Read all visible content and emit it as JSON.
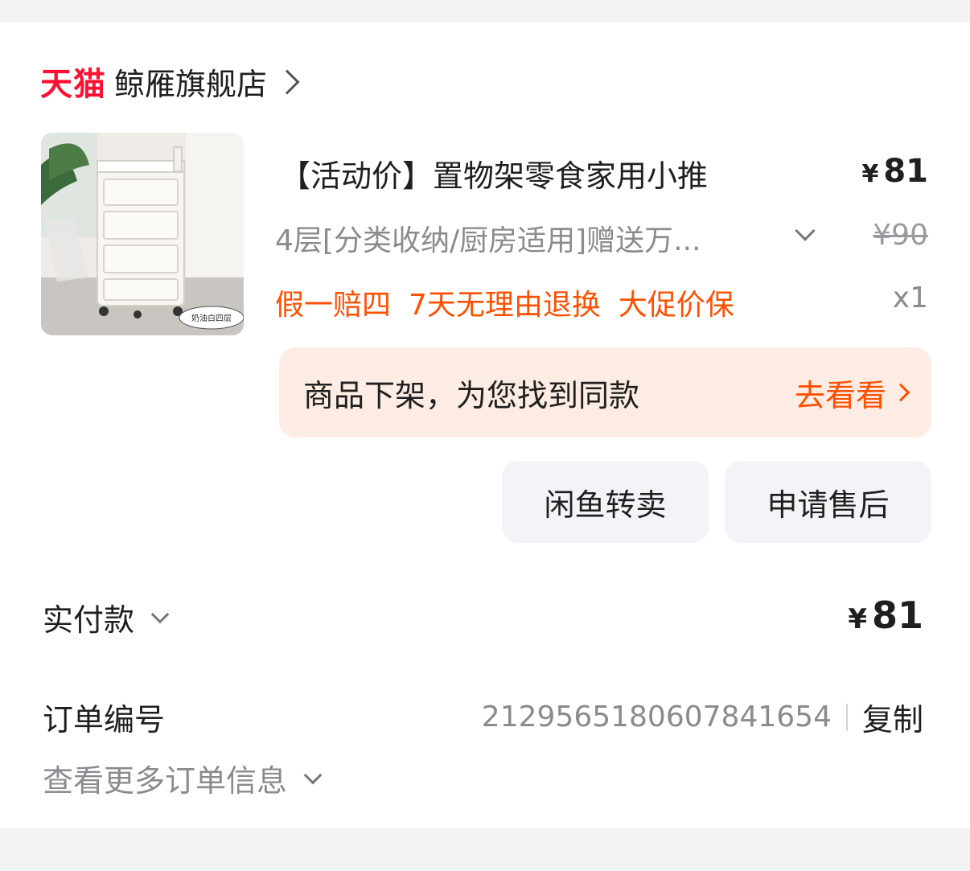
{
  "store": {
    "platform_logo": "天猫",
    "name": "鲸雁旗舰店",
    "chevron_icon": "chevron-right-icon"
  },
  "product": {
    "image_caption": "奶油白四层",
    "title": "【活动价】置物架零食家用小推",
    "price_symbol": "¥",
    "price": "81",
    "sku": "4层[分类收纳/厨房适用]赠送万...",
    "original_price": "¥90",
    "services": [
      "假一赔四",
      "7天无理由退换",
      "大促价保"
    ],
    "quantity": "x1"
  },
  "notice": {
    "text": "商品下架，为您找到同款",
    "link": "去看看"
  },
  "actions": {
    "resell": "闲鱼转卖",
    "after_sale": "申请售后"
  },
  "payment": {
    "label": "实付款",
    "symbol": "¥",
    "amount": "81"
  },
  "order": {
    "label": "订单编号",
    "number": "2129565180607841654",
    "copy": "复制",
    "more_info": "查看更多订单信息"
  },
  "colors": {
    "accent": "#ff5000",
    "tmall_red": "#ff1133",
    "notice_bg": "#fdece4",
    "button_bg": "#f2f4f7"
  }
}
